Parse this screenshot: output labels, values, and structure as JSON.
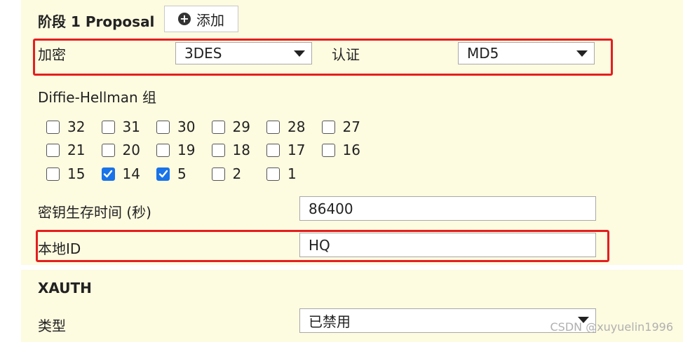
{
  "phase1": {
    "title": "阶段 1 Proposal",
    "add_button": "添加",
    "encryption": {
      "label": "加密",
      "value": "3DES"
    },
    "authentication": {
      "label": "认证",
      "value": "MD5"
    },
    "dh_group": {
      "label": "Diffie-Hellman 组",
      "rows": [
        [
          {
            "num": "32",
            "checked": false
          },
          {
            "num": "31",
            "checked": false
          },
          {
            "num": "30",
            "checked": false
          },
          {
            "num": "29",
            "checked": false
          },
          {
            "num": "28",
            "checked": false
          },
          {
            "num": "27",
            "checked": false
          }
        ],
        [
          {
            "num": "21",
            "checked": false
          },
          {
            "num": "20",
            "checked": false
          },
          {
            "num": "19",
            "checked": false
          },
          {
            "num": "18",
            "checked": false
          },
          {
            "num": "17",
            "checked": false
          },
          {
            "num": "16",
            "checked": false
          }
        ],
        [
          {
            "num": "15",
            "checked": false
          },
          {
            "num": "14",
            "checked": true
          },
          {
            "num": "5",
            "checked": true
          },
          {
            "num": "2",
            "checked": false
          },
          {
            "num": "1",
            "checked": false
          }
        ]
      ]
    },
    "key_lifetime": {
      "label": "密钥生存时间 (秒)",
      "value": "86400"
    },
    "local_id": {
      "label": "本地ID",
      "value": "HQ"
    }
  },
  "xauth": {
    "title": "XAUTH",
    "type": {
      "label": "类型",
      "value": "已禁用"
    }
  },
  "watermark": "CSDN @xuyuelin1996",
  "colors": {
    "panel_bg": "#fdfbe0",
    "highlight_red": "#e51e1e",
    "checkbox_checked": "#1a73e8"
  }
}
